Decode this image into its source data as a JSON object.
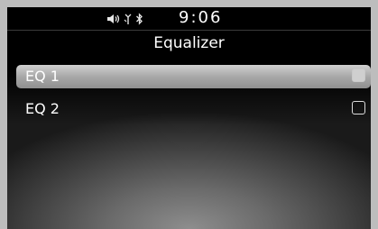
{
  "status_bar": {
    "time": "9:06",
    "icons": [
      "speaker-icon",
      "phone-signal-icon",
      "bluetooth-icon"
    ]
  },
  "screen": {
    "title": "Equalizer"
  },
  "eq_list": {
    "items": [
      {
        "label": "EQ 1",
        "checked": false,
        "highlighted": true
      },
      {
        "label": "EQ 2",
        "checked": false,
        "highlighted": false
      }
    ]
  }
}
